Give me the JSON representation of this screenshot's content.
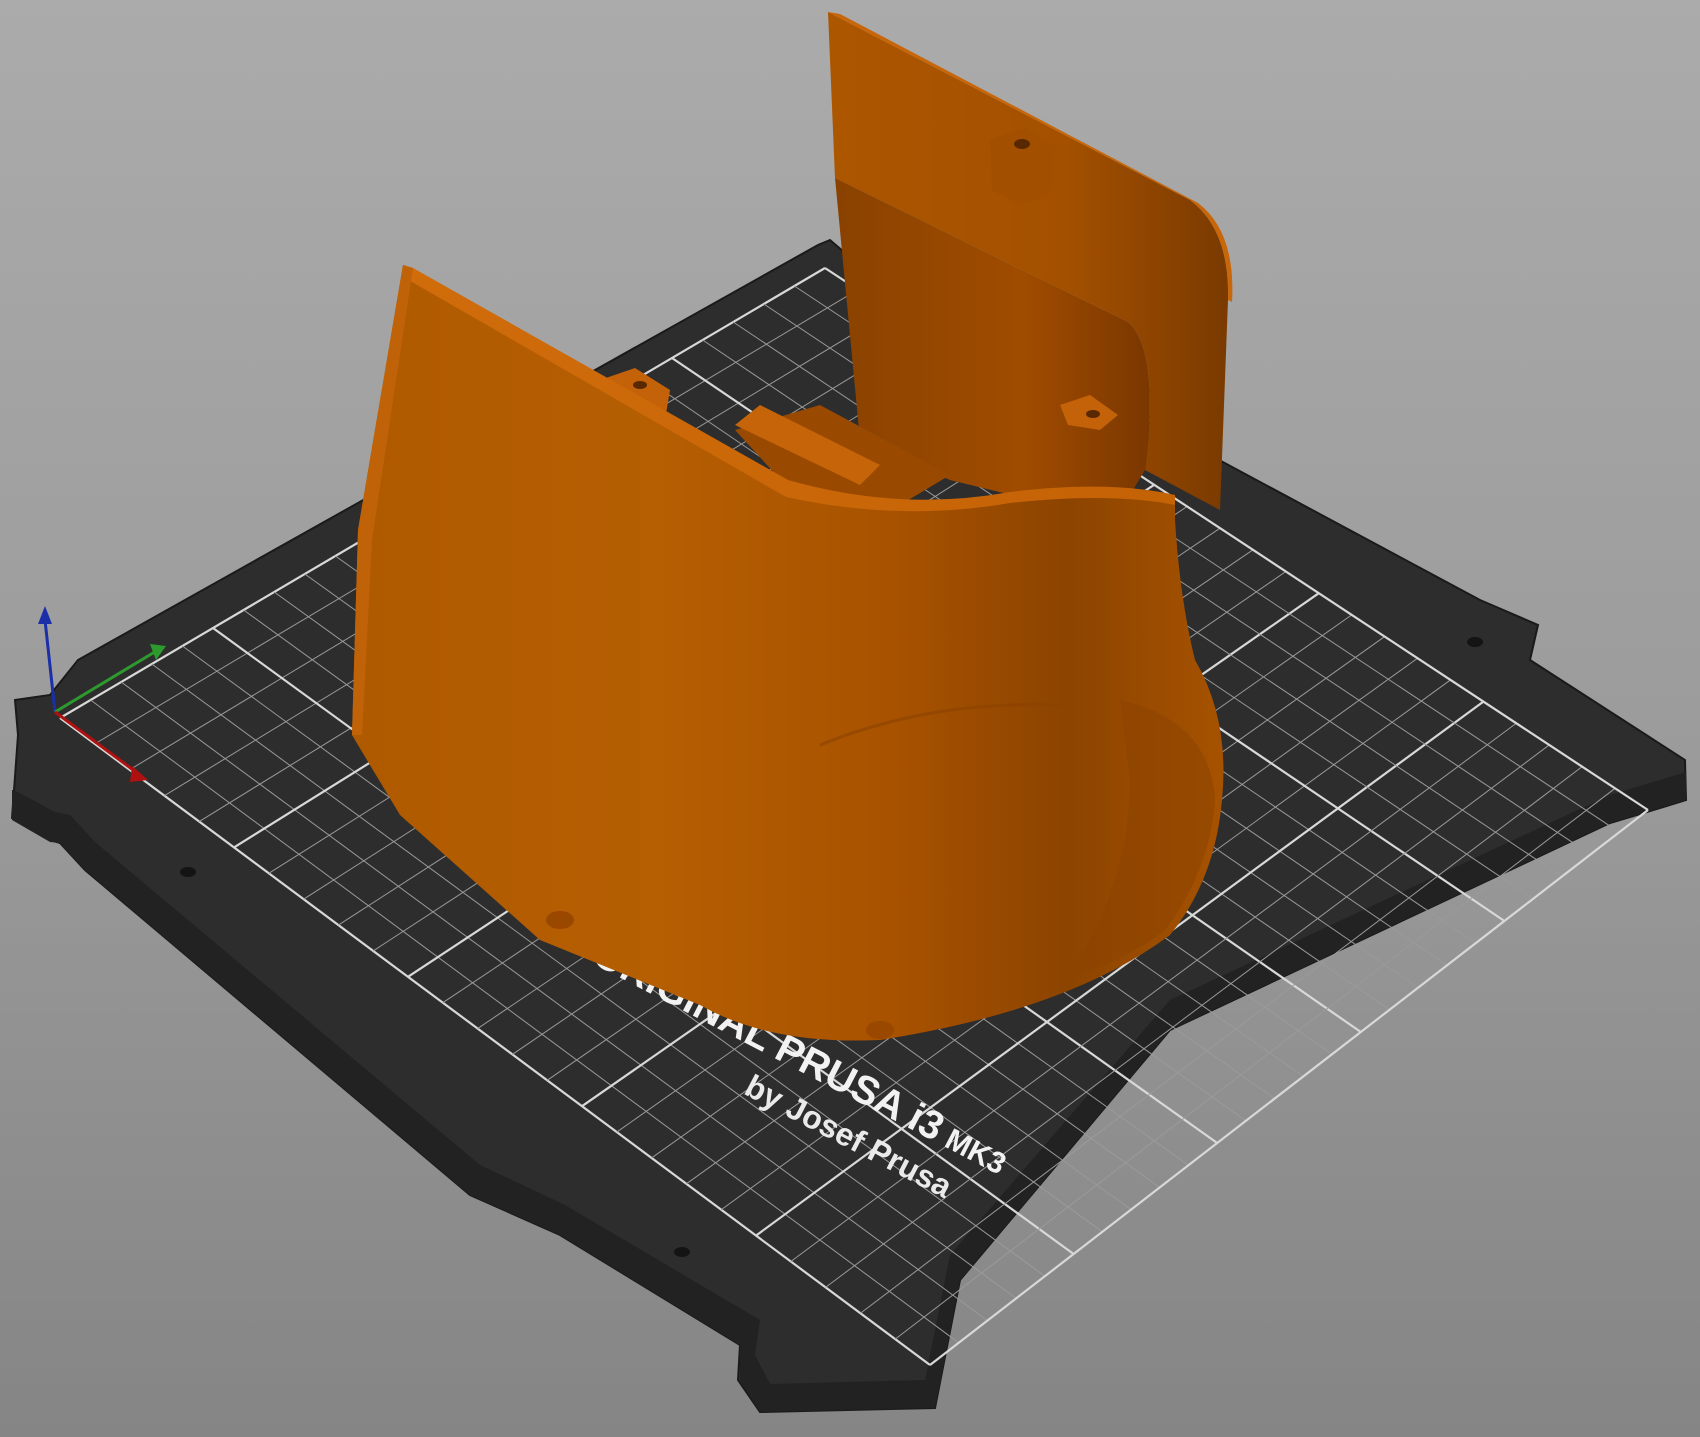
{
  "viewport": {
    "background_color": "#9c9c9c"
  },
  "bed": {
    "plate_color": "#2d2d2d",
    "grid_color": "#9a9a9a",
    "logo_line1": "ORIGINAL PRUSA i3",
    "logo_line1_suffix": "MK3",
    "logo_line2": "by Josef Prusa"
  },
  "model": {
    "color": "#b35a00",
    "highlight_color": "#d57210",
    "shadow_color": "#7a3a00"
  },
  "axes": {
    "x_color": "#b01010",
    "y_color": "#2e9a2e",
    "z_color": "#1a2fa8"
  }
}
